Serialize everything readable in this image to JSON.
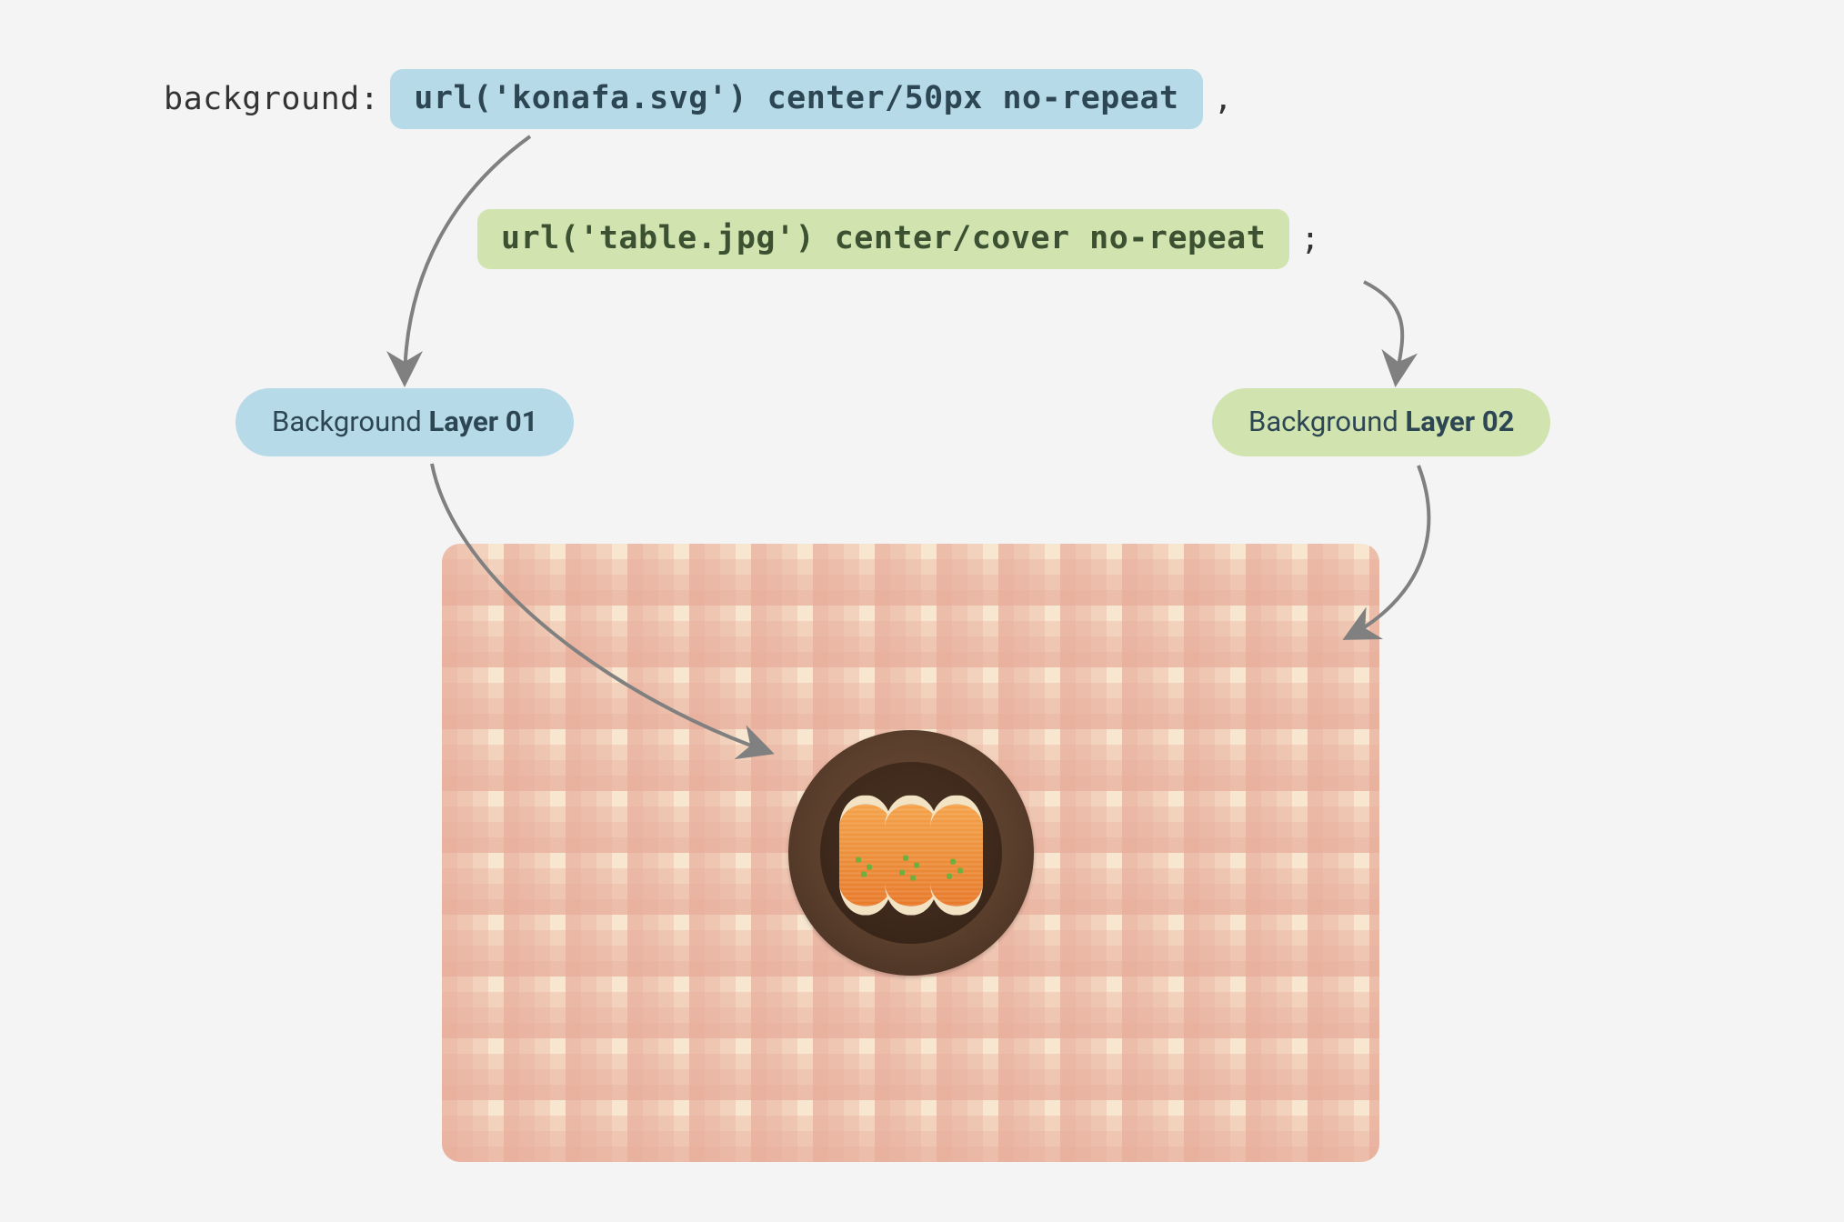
{
  "code": {
    "property": "background:",
    "layer1_value": "url('konafa.svg') center/50px no-repeat",
    "layer1_trailing": ",",
    "layer2_value": "url('table.jpg') center/cover no-repeat",
    "layer2_trailing": ";"
  },
  "labels": {
    "layer1_prefix": "Background ",
    "layer1_bold": "Layer 01",
    "layer2_prefix": "Background ",
    "layer2_bold": "Layer 02"
  },
  "colors": {
    "blue_bg": "#b7dae8",
    "green_bg": "#d1e3af",
    "page_bg": "#f4f4f4",
    "arrow": "#808080"
  }
}
